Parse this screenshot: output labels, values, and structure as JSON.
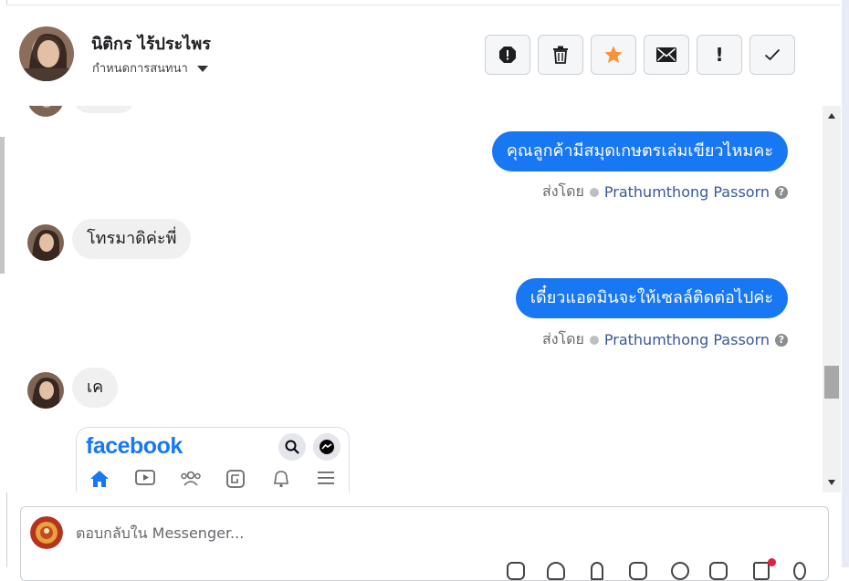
{
  "contact": {
    "name": "นิติกร ไร้ประไพร",
    "assign_label": "กำหนดการสนทนา"
  },
  "toolbar": {
    "buttons": [
      {
        "icon": "spam-icon"
      },
      {
        "icon": "trash-icon"
      },
      {
        "icon": "star-icon",
        "color": "#f7923a"
      },
      {
        "icon": "envelope-icon"
      },
      {
        "icon": "exclamation-icon",
        "text": "!"
      },
      {
        "icon": "checkmark-icon"
      }
    ]
  },
  "messages": [
    {
      "direction": "out",
      "text": "คุณลูกค้ามีสมุดเกษตรเล่มเขียวไหมคะ",
      "sent_by_prefix": "ส่งโดย",
      "sent_by_name": "Prathumthong Passorn"
    },
    {
      "direction": "in",
      "text": "โทรมาดิค่ะพี่"
    },
    {
      "direction": "out",
      "text": "เดี๋ยวแอดมินจะให้เซลล์ติดต่อไปค่ะ",
      "sent_by_prefix": "ส่งโดย",
      "sent_by_name": "Prathumthong Passorn"
    },
    {
      "direction": "in",
      "text": "เค"
    }
  ],
  "attachment": {
    "logo_text": "facebook"
  },
  "composer": {
    "placeholder": "ตอบกลับใน Messenger..."
  },
  "colors": {
    "accent": "#1877f2",
    "star": "#f7923a"
  }
}
